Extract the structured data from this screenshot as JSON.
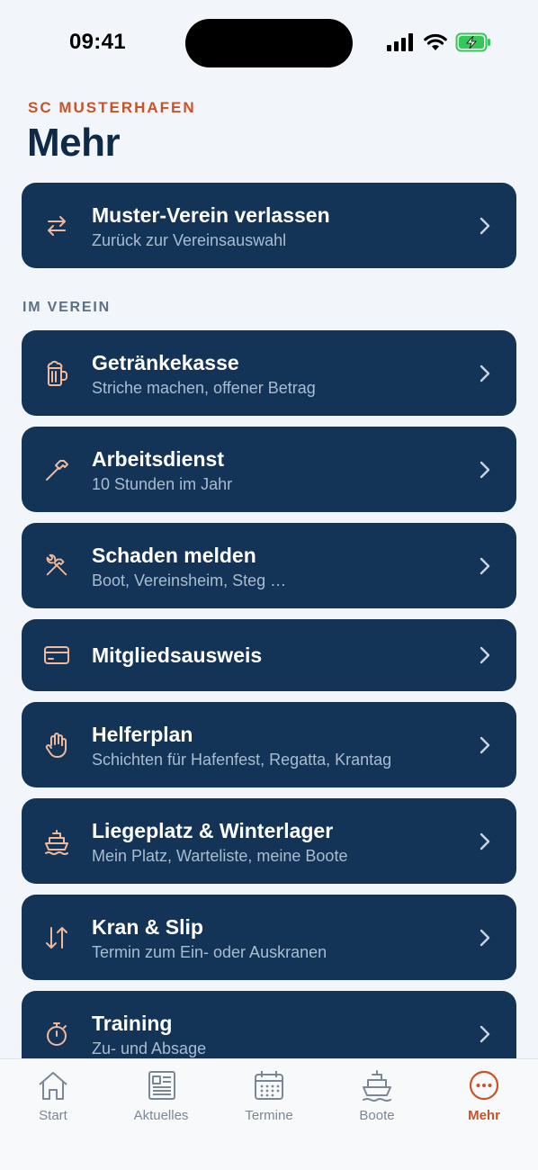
{
  "status_bar": {
    "time": "09:41"
  },
  "header": {
    "club": "SC MUSTERHAFEN",
    "title": "Mehr"
  },
  "leave_card": {
    "title": "Muster-Verein verlassen",
    "subtitle": "Zurück zur Vereinsauswahl",
    "icon": "swap-arrows-icon"
  },
  "section": {
    "label": "IM VEREIN"
  },
  "items": [
    {
      "title": "Getränkekasse",
      "subtitle": "Striche machen, offener Betrag",
      "icon": "beer-mug-icon"
    },
    {
      "title": "Arbeitsdienst",
      "subtitle": "10 Stunden im Jahr",
      "icon": "hammer-icon"
    },
    {
      "title": "Schaden melden",
      "subtitle": "Boot, Vereinsheim, Steg …",
      "icon": "tools-icon"
    },
    {
      "title": "Mitgliedsausweis",
      "subtitle": "",
      "icon": "credit-card-icon"
    },
    {
      "title": "Helferplan",
      "subtitle": "Schichten für Hafenfest, Regatta, Krantag",
      "icon": "hand-icon"
    },
    {
      "title": "Liegeplatz & Winterlager",
      "subtitle": "Mein Platz, Warteliste, meine Boote",
      "icon": "ship-icon"
    },
    {
      "title": "Kran & Slip",
      "subtitle": "Termin zum Ein- oder Auskranen",
      "icon": "up-down-arrows-icon"
    },
    {
      "title": "Training",
      "subtitle": "Zu- und Absage",
      "icon": "stopwatch-icon"
    }
  ],
  "tabs": [
    {
      "label": "Start",
      "icon": "home-icon",
      "active": false
    },
    {
      "label": "Aktuelles",
      "icon": "newspaper-icon",
      "active": false
    },
    {
      "label": "Termine",
      "icon": "calendar-icon",
      "active": false
    },
    {
      "label": "Boote",
      "icon": "ship-icon",
      "active": false
    },
    {
      "label": "Mehr",
      "icon": "more-icon",
      "active": true
    }
  ],
  "colors": {
    "accent": "#c8522a",
    "card": "#133456",
    "background": "#f2f5f9",
    "icon": "#f0b99c"
  }
}
